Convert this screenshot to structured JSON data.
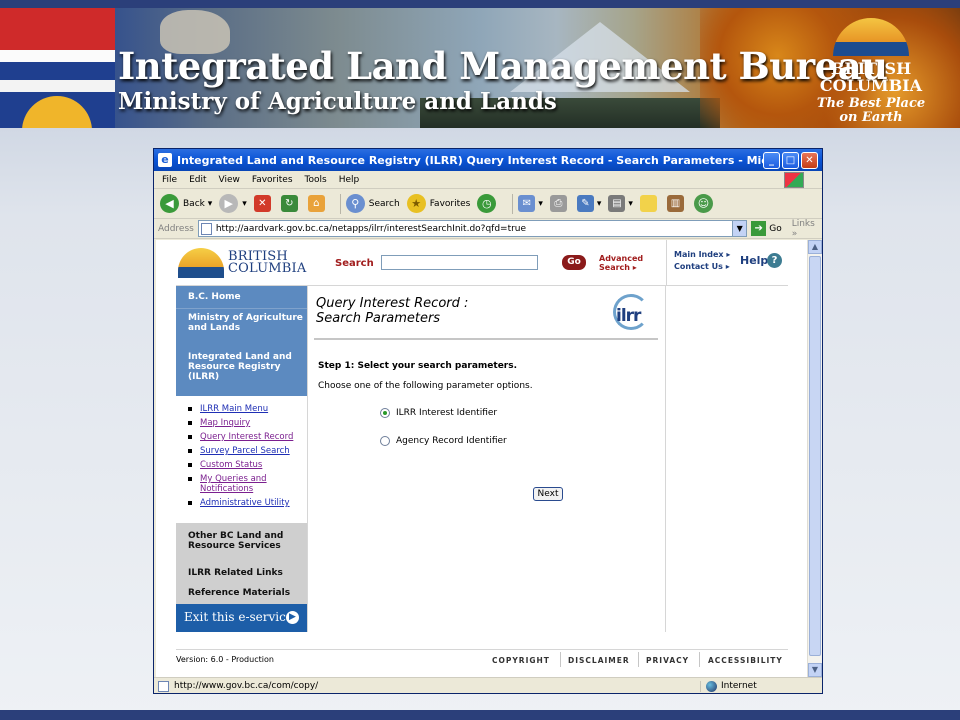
{
  "banner": {
    "title": "Integrated Land Management Bureau",
    "subtitle": "Ministry of Agriculture and Lands",
    "bc_logo_line1": "BRITISH",
    "bc_logo_line2": "COLUMBIA",
    "bc_logo_tagline": "The Best Place on Earth"
  },
  "browser": {
    "window_title": "Integrated Land and Resource Registry (ILRR) Query Interest Record - Search Parameters - Microsoft Internet Explorer",
    "menu": [
      "File",
      "Edit",
      "View",
      "Favorites",
      "Tools",
      "Help"
    ],
    "toolbar": {
      "back": "Back",
      "search": "Search",
      "favorites": "Favorites"
    },
    "address_label": "Address",
    "address": "http://aardvark.gov.bc.ca/netapps/ilrr/interestSearchInit.do?qfd=true",
    "go": "Go",
    "links": "Links",
    "status_url": "http://www.gov.bc.ca/com/copy/",
    "status_zone": "Internet"
  },
  "page": {
    "logo_line1": "BRITISH",
    "logo_line2": "COLUMBIA",
    "search_label": "Search",
    "search_value": "",
    "go_button": "Go",
    "advanced_search_line1": "Advanced",
    "advanced_search_line2": "Search",
    "main_index": "Main Index",
    "contact_us": "Contact Us",
    "help": "Help",
    "nav": {
      "home": "B.C. Home",
      "ministry": "Ministry of Agriculture and Lands",
      "ilrr": "Integrated Land and Resource Registry (ILRR)",
      "links": [
        "ILRR Main Menu",
        "Map Inquiry",
        "Query Interest Record",
        "Survey Parcel Search",
        "Custom Status",
        "My Queries and Notifications",
        "Administrative Utility"
      ],
      "other_services": "Other BC Land and Resource Services",
      "related_links": "ILRR Related Links",
      "reference_materials": "Reference Materials",
      "exit": "Exit this e-service"
    },
    "title_line1": "Query Interest Record :",
    "title_line2": "Search Parameters",
    "ilrr_logo": "ilrr",
    "step": "Step 1: Select your search parameters.",
    "choose": "Choose one of the following parameter options.",
    "options": [
      "ILRR Interest Identifier",
      "Agency Record Identifier"
    ],
    "selected_option": "ILRR Interest Identifier",
    "next_button": "Next",
    "footer": {
      "version": "Version: 6.0 - Production",
      "links": [
        "COPYRIGHT",
        "DISCLAIMER",
        "PRIVACY",
        "ACCESSIBILITY"
      ]
    }
  }
}
